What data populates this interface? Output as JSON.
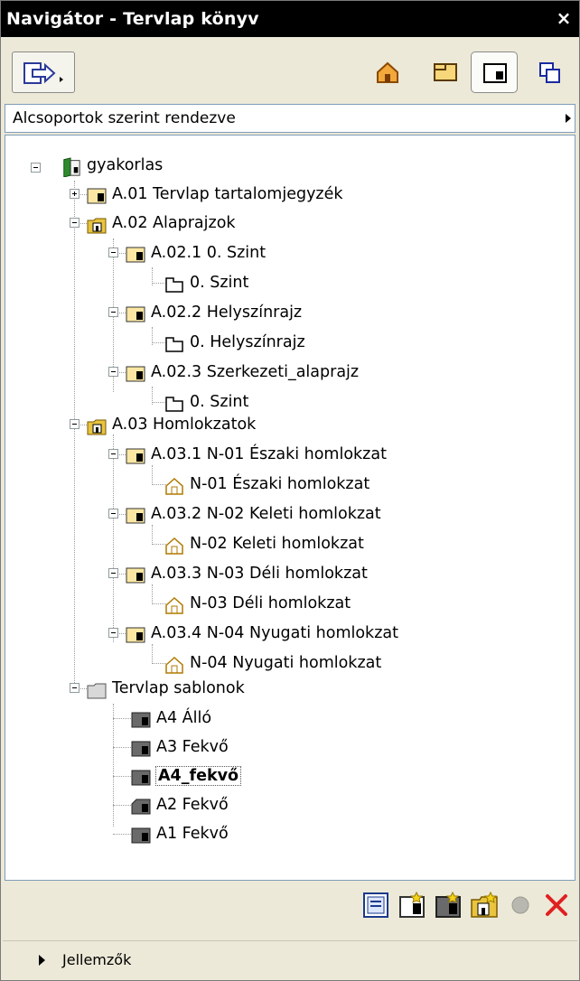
{
  "window": {
    "title": "Navigátor - Tervlap könyv",
    "close_label": "×"
  },
  "dropdown": {
    "selected": "Alcsoportok szerint rendezve"
  },
  "tree": {
    "root": "gyakorlas",
    "items": [
      "A.01 Tervlap tartalomjegyzék",
      "A.02 Alaprajzok",
      "A.02.1 0. Szint",
      "0. Szint",
      "A.02.2 Helyszínrajz",
      "0. Helyszínrajz",
      "A.02.3 Szerkezeti_alaprajz",
      "0. Szint",
      "A.03 Homlokzatok",
      "A.03.1 N-01 Északi homlokzat",
      "N-01 Északi homlokzat",
      "A.03.2 N-02 Keleti homlokzat",
      "N-02 Keleti homlokzat",
      "A.03.3 N-03 Déli homlokzat",
      "N-03 Déli homlokzat",
      "A.03.4 N-04 Nyugati homlokzat",
      "N-04 Nyugati homlokzat",
      "Tervlap sablonok",
      "A4 Álló",
      "A3 Fekvő",
      "A4_fekvő",
      "A2 Fekvő",
      "A1 Fekvő"
    ]
  },
  "infobar": {
    "label": "Jellemzők"
  },
  "colors": {
    "title_bg": "#000000",
    "panel_bg": "#ece9d8",
    "tree_bg": "#ffffff",
    "delete_red": "#e02020",
    "folder_yellow": "#e8c440"
  }
}
